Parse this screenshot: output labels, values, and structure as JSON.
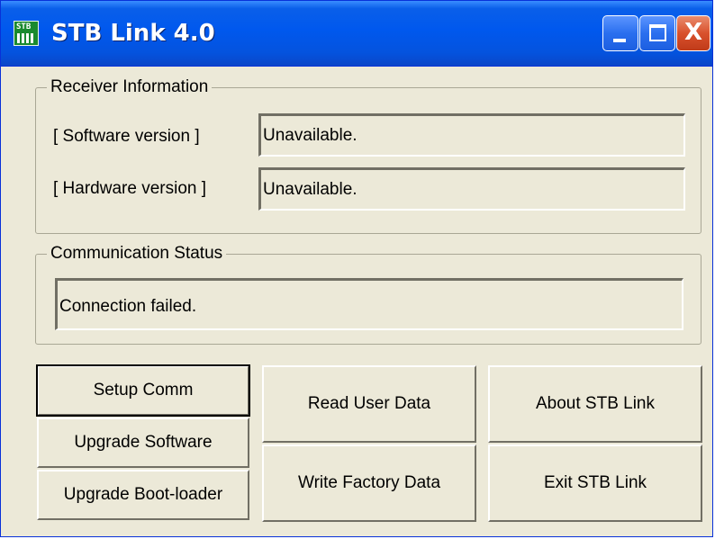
{
  "window": {
    "title": "STB Link 4.0",
    "icon": "stb-app-icon",
    "icon_text": "STB",
    "controls": {
      "minimize": "minimize-icon",
      "maximize": "maximize-icon",
      "close": "close-icon",
      "close_glyph": "X"
    }
  },
  "receiver_info": {
    "legend": "Receiver Information",
    "software": {
      "label": "[ Software version ]",
      "value": "Unavailable."
    },
    "hardware": {
      "label": "[ Hardware version ]",
      "value": "Unavailable."
    }
  },
  "communication": {
    "legend": "Communication Status",
    "status": "Connection failed."
  },
  "buttons": {
    "setup_comm": "Setup Comm",
    "upgrade_software": "Upgrade Software",
    "upgrade_bootloader": "Upgrade Boot-loader",
    "read_user_data": "Read User Data",
    "write_factory_data": "Write Factory Data",
    "about": "About STB Link",
    "exit": "Exit STB Link"
  },
  "colors": {
    "titlebar": "#0058ee",
    "window_face": "#ece9d8",
    "close_button": "#d9512c"
  }
}
